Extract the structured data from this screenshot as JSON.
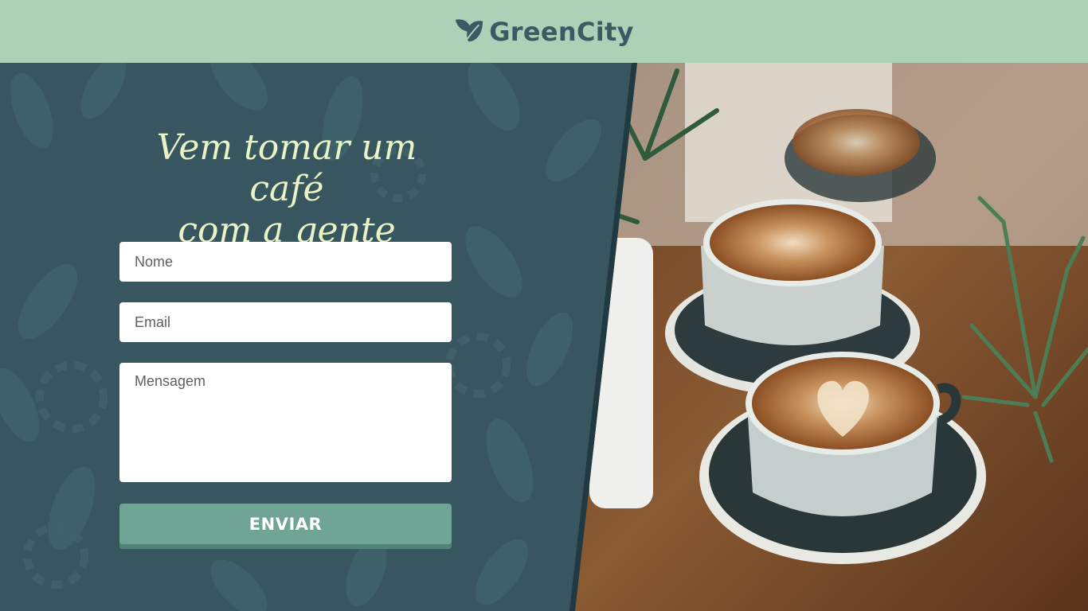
{
  "header": {
    "brand": "GreenCity",
    "logo_icon": "leaf-icon",
    "background": "#acd1b7",
    "text_color": "#3c5a63"
  },
  "form": {
    "title_line1": "Vem tomar um café",
    "title_line2": "com a gente",
    "name_placeholder": "Nome",
    "email_placeholder": "Email",
    "message_placeholder": "Mensagem",
    "submit_label": "ENVIAR"
  },
  "colors": {
    "panel": "#385660",
    "title": "#eaf3c6",
    "button": "#70a596",
    "button_shadow": "#4d8677"
  },
  "photo": {
    "subject": "coffee-cups-photo"
  }
}
